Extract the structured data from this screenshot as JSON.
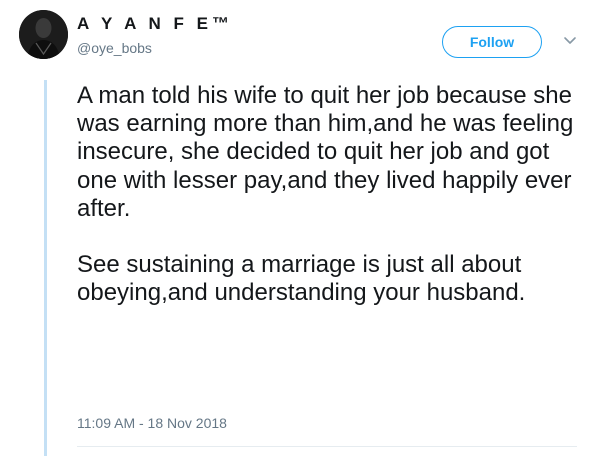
{
  "author": {
    "display_name": "A Y A N F E™",
    "handle": "@oye_bobs",
    "avatar_icon": "profile-photo"
  },
  "actions": {
    "follow_label": "Follow",
    "menu_icon": "chevron-down-icon"
  },
  "tweet": {
    "paragraphs": [
      "A man told his wife to quit her job because she was earning more than him,and he was feeling insecure, she decided to quit her job and got one with lesser pay,and they lived happily ever after.",
      "See sustaining a marriage is just all about obeying,and understanding your husband."
    ],
    "timestamp": "11:09 AM - 18 Nov 2018"
  },
  "colors": {
    "accent": "#1da1f2",
    "thread_line": "#c4e0f5",
    "secondary_text": "#657786",
    "primary_text": "#14171a"
  }
}
